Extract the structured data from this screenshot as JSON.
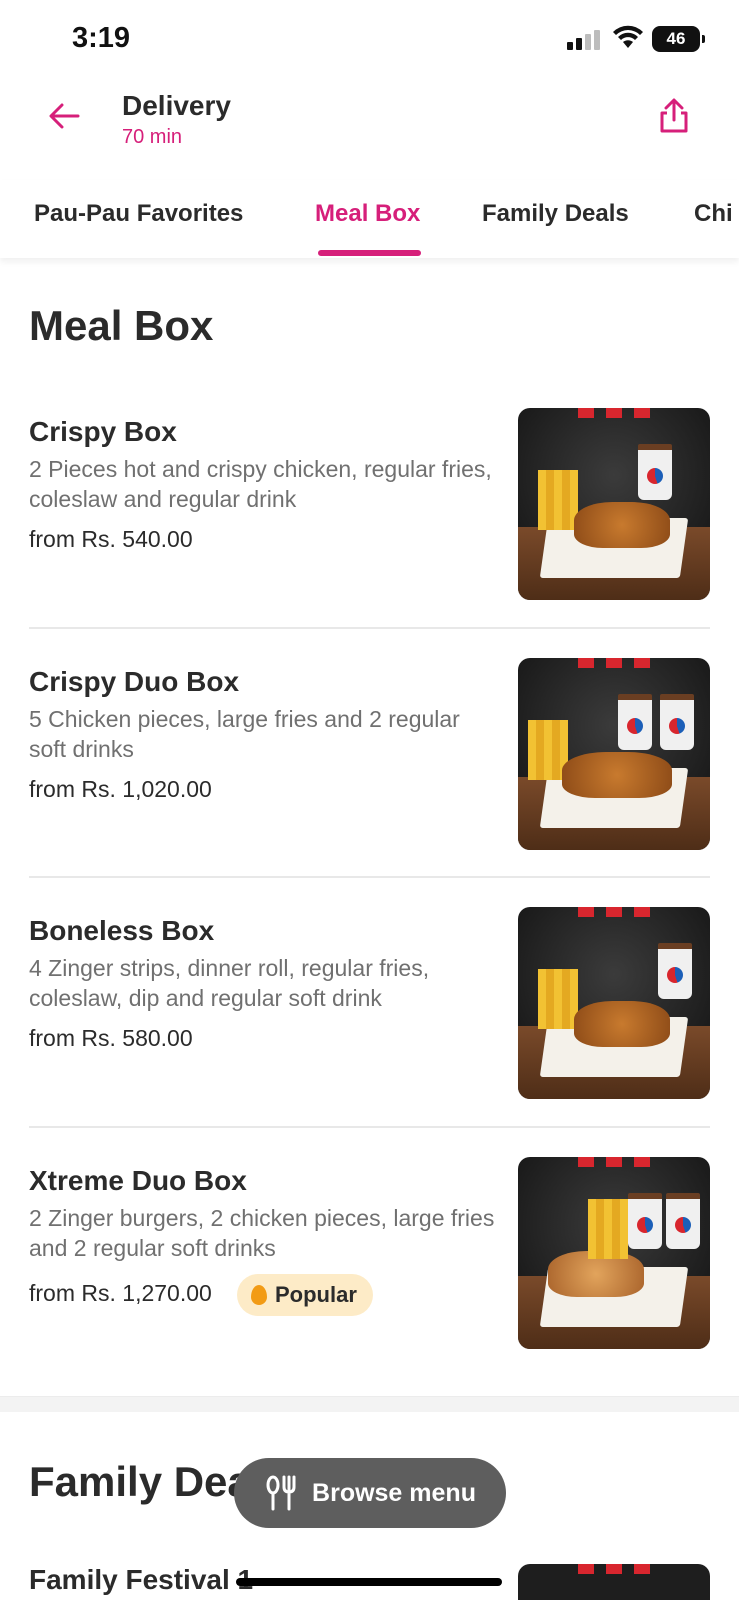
{
  "status_bar": {
    "time": "3:19",
    "battery": "46"
  },
  "header": {
    "title": "Delivery",
    "subtitle": "70 min"
  },
  "tabs": [
    {
      "label": "Pau-Pau Favorites"
    },
    {
      "label": "Meal Box",
      "active": true
    },
    {
      "label": "Family Deals"
    },
    {
      "label": "Chi"
    }
  ],
  "sections": [
    {
      "title": "Meal Box",
      "items": [
        {
          "name": "Crispy Box",
          "desc": "2 Pieces hot and crispy chicken, regular fries, coleslaw and regular drink",
          "price": "from Rs. 540.00"
        },
        {
          "name": "Crispy Duo Box",
          "desc": "5 Chicken pieces, large fries and 2 regular soft drinks",
          "price": "from Rs. 1,020.00"
        },
        {
          "name": "Boneless Box",
          "desc": "4 Zinger strips, dinner roll, regular fries, coleslaw, dip and regular soft drink",
          "price": "from Rs. 580.00"
        },
        {
          "name": "Xtreme Duo Box",
          "desc": "2 Zinger burgers, 2 chicken pieces, large fries and 2 regular soft drinks",
          "price": "from Rs. 1,270.00",
          "badge": "Popular"
        }
      ]
    },
    {
      "title": "Family Dea",
      "items": [
        {
          "name": "Family Festival 1"
        }
      ]
    }
  ],
  "browse_button": {
    "label": "Browse menu"
  },
  "colors": {
    "accent": "#d61f7a",
    "badge_bg": "#fdebc7",
    "browse_bg": "#5e5e5e"
  }
}
